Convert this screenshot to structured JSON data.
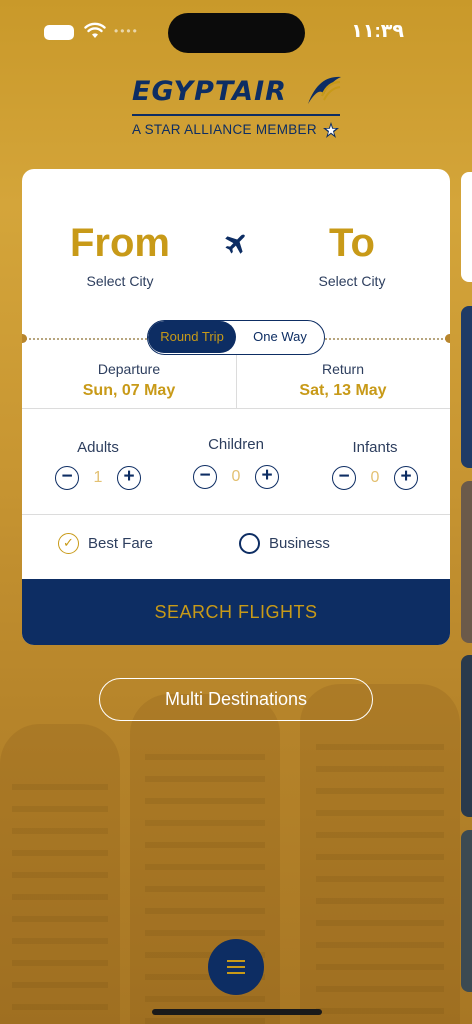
{
  "status_bar": {
    "time": "١١:٣٩"
  },
  "brand": {
    "name": "EGYPTAIR",
    "tagline": "A STAR ALLIANCE MEMBER"
  },
  "route": {
    "from_label": "From",
    "from_sub": "Select City",
    "to_label": "To",
    "to_sub": "Select City"
  },
  "trip_type": {
    "options": [
      "Round Trip",
      "One Way"
    ],
    "selected": "Round Trip"
  },
  "dates": {
    "departure_label": "Departure",
    "departure_value": "Sun, 07 May",
    "return_label": "Return",
    "return_value": "Sat, 13 May"
  },
  "passengers": [
    {
      "label": "Adults",
      "value": "1"
    },
    {
      "label": "Children",
      "value": "0"
    },
    {
      "label": "Infants",
      "value": "0"
    }
  ],
  "cabin": {
    "options": [
      "Best Fare",
      "Business"
    ],
    "selected": "Best Fare"
  },
  "actions": {
    "search": "SEARCH FLIGHTS",
    "multi": "Multi Destinations"
  },
  "colors": {
    "navy": "#0d2d63",
    "gold": "#c89a18",
    "background": "#c9992a"
  },
  "icons": [
    "battery-icon",
    "wifi-icon",
    "plane-icon",
    "minus-icon",
    "plus-icon",
    "check-icon",
    "menu-icon"
  ]
}
